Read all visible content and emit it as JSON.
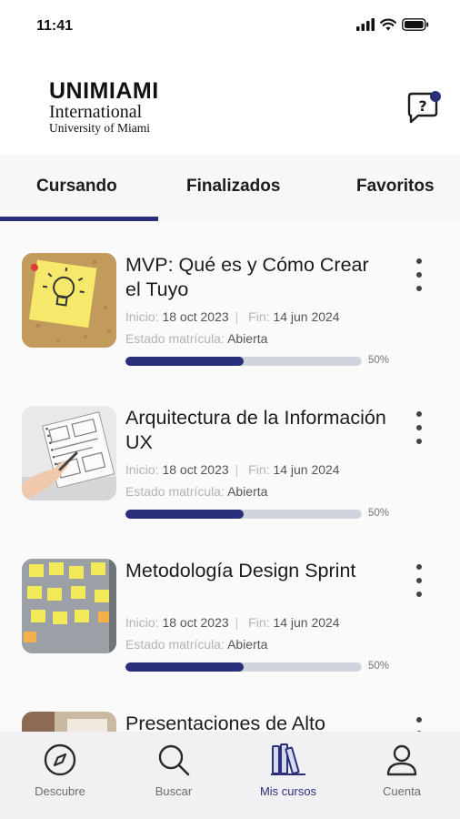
{
  "status_bar": {
    "time": "11:41"
  },
  "header": {
    "logo_main": "UNIMIAMI",
    "logo_sub": "International",
    "logo_sub2": "University of Miami"
  },
  "tabs": [
    {
      "label": "Cursando",
      "active": true
    },
    {
      "label": "Finalizados",
      "active": false
    },
    {
      "label": "Favoritos",
      "active": false
    }
  ],
  "labels": {
    "start": "Inicio:",
    "end": "Fin:",
    "enrollment_status": "Estado matrícula:"
  },
  "courses": [
    {
      "title": "MVP: Qué es y Cómo Crear el Tuyo",
      "start_date": "18 oct 2023",
      "end_date": "14 jun 2024",
      "status": "Abierta",
      "progress": 50,
      "progress_label": "50%",
      "thumbnail": "lightbulb-sticky-note"
    },
    {
      "title": "Arquitectura de la Información UX",
      "start_date": "18 oct 2023",
      "end_date": "14 jun 2024",
      "status": "Abierta",
      "progress": 50,
      "progress_label": "50%",
      "thumbnail": "hand-sketching-wireframes"
    },
    {
      "title": "Metodología Design Sprint",
      "start_date": "18 oct 2023",
      "end_date": "14 jun 2024",
      "status": "Abierta",
      "progress": 50,
      "progress_label": "50%",
      "thumbnail": "sticky-notes-board"
    },
    {
      "title": "Presentaciones de Alto",
      "thumbnail": "presentation-room"
    }
  ],
  "bottom_nav": [
    {
      "label": "Descubre",
      "icon": "compass-icon",
      "active": false
    },
    {
      "label": "Buscar",
      "icon": "search-icon",
      "active": false
    },
    {
      "label": "Mis cursos",
      "icon": "books-icon",
      "active": true
    },
    {
      "label": "Cuenta",
      "icon": "user-icon",
      "active": false
    }
  ],
  "colors": {
    "accent": "#2a2f7a",
    "progress_track": "#d1d3dd",
    "nav_background": "#f1f1f3"
  }
}
